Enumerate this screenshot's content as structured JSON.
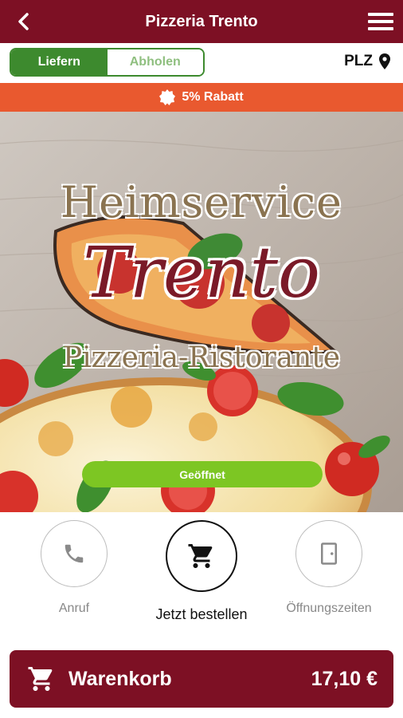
{
  "header": {
    "title": "Pizzeria Trento",
    "back_icon": "chevron-left-icon",
    "menu_icon": "hamburger-menu-icon"
  },
  "delivery": {
    "options": [
      {
        "label": "Liefern",
        "active": true
      },
      {
        "label": "Abholen",
        "active": false
      }
    ],
    "plz_label": "PLZ",
    "plz_icon": "map-pin-icon"
  },
  "discount": {
    "icon": "badge-icon",
    "text": "5% Rabatt"
  },
  "hero": {
    "logo_line1": "Heimservice",
    "logo_line2": "Trento",
    "logo_line3": "Pizzeria-Ristorante",
    "status": "Geöffnet"
  },
  "actions": [
    {
      "label": "Anruf",
      "icon": "phone-icon"
    },
    {
      "label": "Jetzt bestellen",
      "icon": "cart-icon"
    },
    {
      "label": "Öffnungszeiten",
      "icon": "door-icon"
    }
  ],
  "cart": {
    "label": "Warenkorb",
    "total": "17,10 €",
    "icon": "cart-icon"
  },
  "colors": {
    "brand": "#7d1024",
    "green": "#3d8a2e",
    "discount": "#e9592f",
    "open": "#7dc623"
  }
}
